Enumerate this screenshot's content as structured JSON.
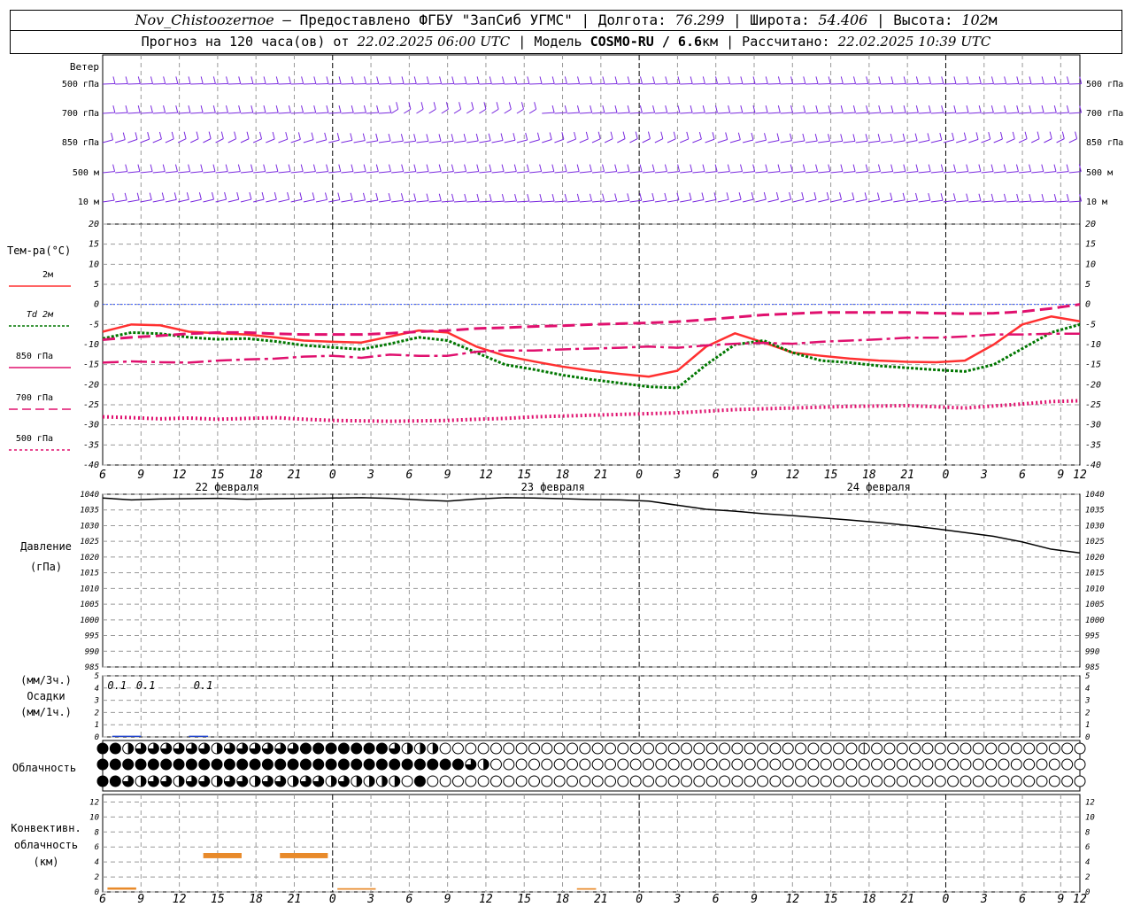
{
  "header": {
    "station": "Nov_Chistoozernoe",
    "provider_text": " – Предоставлено ФГБУ \"ЗапСиб УГМС\" | Долгота: ",
    "lon": "76.299",
    "lat_label": " | Широта: ",
    "lat": "54.406",
    "alt_label": " | Высота: ",
    "alt": "102",
    "alt_unit": "м",
    "forecast_label": "Прогноз на 120 часа(ов) от ",
    "forecast_time": "22.02.2025 06:00 UTC",
    "model_label": "  | Модель ",
    "model": "COSMO-RU / 6.6",
    "model_unit": "км",
    "calc_label": " | Рассчитано: ",
    "calc_time": "22.02.2025 10:39 UTC"
  },
  "wind_panel": {
    "title": "Ветер",
    "levels": [
      "500 гПа",
      "700 гПа",
      "850 гПа",
      "500 м",
      "10  м"
    ],
    "levels_right": [
      "500 гПа",
      "700 гПа",
      "850 гПа",
      "500 м",
      "10  м"
    ]
  },
  "temp_panel": {
    "ylabel": "Тем-ра(°C)",
    "legend": [
      {
        "label": "2м",
        "color": "#ff3030",
        "dash": ""
      },
      {
        "label": "Td  2м",
        "color": "#007700",
        "dash": "3,2"
      },
      {
        "label": "850 гПа",
        "color": "#e0106e",
        "dash": ""
      },
      {
        "label": "700 гПа",
        "color": "#e0106e",
        "dash": "10,5"
      },
      {
        "label": "500 гПа",
        "color": "#e0106e",
        "dash": "3,3"
      }
    ]
  },
  "time_axis": {
    "ticks": [
      "6",
      "9",
      "12",
      "15",
      "18",
      "21",
      "0",
      "3",
      "6",
      "9",
      "12",
      "15",
      "18",
      "21",
      "0",
      "3",
      "6",
      "9",
      "12",
      "15",
      "18",
      "21",
      "0",
      "3",
      "6",
      "9",
      "12"
    ],
    "dates": [
      "22 февраля",
      "23 февраля",
      "24 февраля"
    ]
  },
  "pressure_panel": {
    "ylabel_1": "Давление",
    "ylabel_2": "(гПа)"
  },
  "precip_panel": {
    "ylabel_1": "(мм/3ч.)",
    "ylabel_2": "Осадки",
    "ylabel_3": "(мм/1ч.)",
    "labels": [
      {
        "hour": 1.5,
        "text": "0.1"
      },
      {
        "hour": 4.5,
        "text": "0.1"
      },
      {
        "hour": 10.5,
        "text": "0.1"
      }
    ]
  },
  "cloud_panel": {
    "label": "Облачность"
  },
  "conv_panel": {
    "ylabel_1": "Конвективн.",
    "ylabel_2": "облачность",
    "ylabel_3": "(км)"
  },
  "chart_data": [
    {
      "type": "line",
      "title": "Тем-ра(°C)",
      "ylim": [
        -40,
        20
      ],
      "yticks": [
        -40,
        -35,
        -30,
        -25,
        -20,
        -15,
        -10,
        -5,
        0,
        5,
        10,
        15,
        20
      ],
      "x_hours": [
        0,
        3,
        6,
        9,
        12,
        15,
        18,
        21,
        24,
        27,
        30,
        33,
        36,
        39,
        42,
        45,
        48,
        51,
        54,
        57,
        60,
        63,
        66,
        69,
        72,
        75,
        78
      ],
      "series": [
        {
          "name": "2м",
          "color": "#ff3030",
          "values": [
            -6.8,
            -5.0,
            -5.2,
            -6.8,
            -7.2,
            -7.5,
            -8.2,
            -9.0,
            -9.3,
            -9.5,
            -8.0,
            -6.5,
            -7.0,
            -10.5,
            -12.8,
            -14.2,
            -15.5,
            -16.5,
            -17.3,
            -18.0,
            -16.5,
            -10.5,
            -7.2,
            -9.5,
            -12.0,
            -12.8,
            -13.5,
            -14.0,
            -14.3,
            -14.4,
            -14.0,
            -10.0,
            -5.0,
            -3.0,
            -4.2
          ]
        },
        {
          "name": "Td  2м",
          "color": "#007700",
          "values": [
            -8.5,
            -7.0,
            -7.3,
            -8.2,
            -8.7,
            -8.5,
            -9.2,
            -10.2,
            -10.7,
            -11.2,
            -9.8,
            -8.2,
            -9.0,
            -12.0,
            -15.0,
            -16.2,
            -17.6,
            -18.7,
            -19.6,
            -20.5,
            -20.8,
            -15.0,
            -10.0,
            -9.0,
            -12.0,
            -14.0,
            -14.5,
            -15.3,
            -15.8,
            -16.3,
            -16.7,
            -15.0,
            -11.0,
            -7.0,
            -5.0,
            -5.2
          ]
        },
        {
          "name": "850 гПа",
          "color": "#e0106e",
          "values": [
            -14.5,
            -14.2,
            -14.4,
            -14.5,
            -14.0,
            -13.7,
            -13.5,
            -13.0,
            -12.8,
            -13.3,
            -12.5,
            -12.8,
            -12.8,
            -11.8,
            -11.5,
            -11.5,
            -11.2,
            -11.0,
            -10.8,
            -10.5,
            -10.8,
            -10.2,
            -9.8,
            -9.6,
            -9.8,
            -9.3,
            -9.0,
            -8.7,
            -8.3,
            -8.3,
            -8.0,
            -7.5,
            -7.5,
            -7.3,
            -7.3
          ]
        },
        {
          "name": "700 гПа",
          "color": "#e0106e",
          "values": [
            -8.8,
            -8.2,
            -7.8,
            -7.3,
            -7.0,
            -7.0,
            -7.3,
            -7.5,
            -7.5,
            -7.5,
            -7.2,
            -6.8,
            -6.5,
            -6.0,
            -5.8,
            -5.5,
            -5.3,
            -5.0,
            -4.8,
            -4.6,
            -4.3,
            -3.8,
            -3.2,
            -2.6,
            -2.3,
            -2.0,
            -2.0,
            -2.0,
            -2.0,
            -2.2,
            -2.3,
            -2.2,
            -1.8,
            -1.0,
            0.0
          ]
        },
        {
          "name": "500 гПа",
          "color": "#e0106e",
          "values": [
            -28.0,
            -28.2,
            -28.5,
            -28.3,
            -28.6,
            -28.4,
            -28.2,
            -28.6,
            -28.9,
            -29.0,
            -29.1,
            -29.0,
            -28.9,
            -28.6,
            -28.4,
            -28.0,
            -27.8,
            -27.6,
            -27.4,
            -27.2,
            -27.0,
            -26.6,
            -26.2,
            -26.0,
            -25.8,
            -25.6,
            -25.4,
            -25.3,
            -25.2,
            -25.5,
            -25.8,
            -25.3,
            -24.8,
            -24.2,
            -24.0
          ]
        }
      ],
      "series_hours": [
        0,
        3,
        6,
        9,
        12,
        15,
        18,
        21,
        24,
        27,
        30,
        33,
        36,
        39,
        42,
        45,
        48,
        51,
        54,
        57,
        60,
        63,
        66,
        69,
        72,
        75,
        78,
        81,
        84,
        87,
        90,
        93,
        96,
        99,
        102
      ]
    },
    {
      "type": "line",
      "title": "Давление",
      "ylim": [
        985,
        1040
      ],
      "yticks": [
        985,
        990,
        995,
        1000,
        1005,
        1010,
        1015,
        1020,
        1025,
        1030,
        1035,
        1040
      ],
      "series": [
        {
          "name": "",
          "color": "#000000",
          "hours": [
            0,
            3,
            6,
            9,
            12,
            15,
            18,
            21,
            24,
            27,
            30,
            33,
            36,
            39,
            42,
            45,
            48,
            51,
            54,
            57,
            60,
            63,
            66,
            69,
            72,
            75,
            78,
            81,
            84,
            87,
            90,
            93,
            96,
            99,
            102
          ],
          "values": [
            1038.8,
            1038.2,
            1038.5,
            1038.6,
            1038.7,
            1038.4,
            1038.6,
            1038.7,
            1038.8,
            1038.9,
            1038.7,
            1038.2,
            1037.8,
            1038.5,
            1038.9,
            1038.8,
            1038.6,
            1038.3,
            1038.2,
            1037.8,
            1036.5,
            1035.2,
            1034.6,
            1033.8,
            1033.2,
            1032.5,
            1031.8,
            1031.0,
            1030.1,
            1029.0,
            1027.8,
            1026.6,
            1024.8,
            1022.5,
            1021.3
          ]
        }
      ]
    },
    {
      "type": "bar",
      "title": "Осадки",
      "ylim": [
        0,
        5
      ],
      "yticks": [
        0,
        1,
        2,
        3,
        4,
        5
      ],
      "bars": [
        {
          "hour_start": 1,
          "hour_end": 4,
          "value": 0.1,
          "color": "#2244cc"
        },
        {
          "hour_start": 9,
          "hour_end": 11,
          "value": 0.1,
          "color": "#2244cc"
        }
      ]
    },
    {
      "type": "bar",
      "title": "Конвективн. облачность (км)",
      "ylim": [
        0,
        13
      ],
      "yticks": [
        0,
        2,
        4,
        6,
        8,
        10,
        12
      ],
      "segments": [
        {
          "hour_start": 0.5,
          "hour_end": 3.5,
          "bottom": 0.3,
          "top": 0.6,
          "color": "#e88a2a"
        },
        {
          "hour_start": 10.5,
          "hour_end": 14.5,
          "bottom": 4.5,
          "top": 5.2,
          "color": "#e88a2a"
        },
        {
          "hour_start": 18.5,
          "hour_end": 23.5,
          "bottom": 4.5,
          "top": 5.2,
          "color": "#e88a2a"
        },
        {
          "hour_start": 24.5,
          "hour_end": 28.5,
          "bottom": 0.3,
          "top": 0.5,
          "color": "#e88a2a"
        },
        {
          "hour_start": 49.5,
          "hour_end": 51.5,
          "bottom": 0.3,
          "top": 0.5,
          "color": "#e88a2a"
        }
      ]
    },
    {
      "type": "heatmap",
      "title": "Облачность",
      "rows": [
        "4423333332333333444444432220000000000000000000000000000000001000000000000000000000000000000003000000342402323444444",
        "4444444444444444444444444444432000000000000000000000000000000000000000000000000000000000000000300000000044434344444",
        "4432332332332332332322220400000000000000000000000000000000000000000000000000000000000000000000000000000000000000000"
      ],
      "cols": 78,
      "hour_step": 1.3333
    }
  ]
}
